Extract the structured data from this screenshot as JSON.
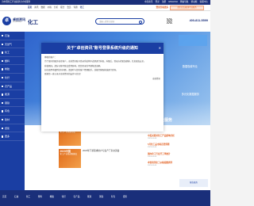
{
  "topbar": {
    "left_text": "为中国化工行业提供全方位服务",
    "links": [
      "卓创资讯",
      "登录",
      "注册",
      "ENGLISH",
      "网站导航",
      "移动端",
      "客服中心"
    ]
  },
  "nav": {
    "items": [
      "首页",
      "资讯",
      "数据",
      "价格",
      "分析",
      "报告",
      "会员",
      "专题",
      "化工"
    ],
    "login": "登录查看更多",
    "promo": "首次关注送更多专业服务"
  },
  "header": {
    "logo_text": "卓创资讯",
    "logo_sub": "SCI99.COM",
    "channel_title": "化工",
    "search_placeholder": "请输入搜索关键词",
    "phone": "400-811-5599"
  },
  "sidebar": {
    "items": [
      "石油",
      "天然气",
      "化工",
      "塑料",
      "橡胶",
      "化纤",
      "农产品",
      "能源",
      "钢铁",
      "有色",
      "建材",
      "纸浆",
      "更多"
    ]
  },
  "banner": {
    "tag1": "数据权威专业",
    "tag2": "多元化数据服务",
    "big_text": "专业服务"
  },
  "modal": {
    "title": "关于\"卓创资讯\"账号登录系统升级的通知",
    "close": "✕",
    "greeting": "尊敬的客户：",
    "paragraphs": [
      "为了更好的服务各位客户，卓创资讯账号登录系统将于近期进行升级，升级后，登录方式更加便捷，信息更加安全。",
      "升级期间，部分功能可能会受到影响，给您带来的不便敬请谅解。",
      "如在使用中遇到任何问题，请及时与您的客户经理联系，或拨打客服热线进行咨询。",
      "感谢您一直以来对卓创资讯的支持与信任！"
    ],
    "signature": "卓创资讯"
  },
  "news": {
    "thumbs": [
      {
        "title": "2023中国",
        "sub": "化工产业发展论坛"
      },
      {
        "title": "2023中国",
        "sub": "化工产业链创新峰会"
      }
    ],
    "left_items": [
      "2023中国塑料产业链发展论坛",
      "2023年下游需求用户与生产厂家交流会"
    ],
    "right_header": "研究观点",
    "right_items": [
      {
        "title": "中美关税对化工产品影响分析",
        "date": "2023-05-08"
      },
      {
        "title": "5月化工品市场走势预测",
        "date": "2023-05-06"
      },
      {
        "title": "国内化工行业开工率统计",
        "date": "2023-05-05"
      },
      {
        "title": "卓创资讯化工价格指数周评",
        "date": "2023-05-04"
      }
    ],
    "right_buttons": [
      "报告服务",
      "数据服务",
      "会员服务"
    ]
  },
  "footer": {
    "items": [
      "首页",
      "石油",
      "化工",
      "塑料",
      "橡胶",
      "化纤",
      "农产品",
      "能源",
      "钢铁",
      "有色",
      "纸浆"
    ]
  }
}
